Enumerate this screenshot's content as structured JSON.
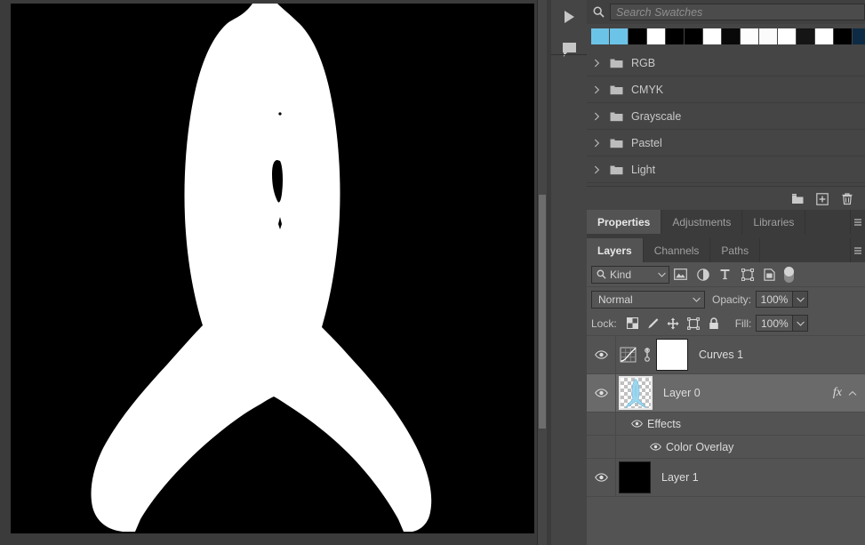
{
  "app": {
    "name": "Adobe Photoshop"
  },
  "document": {
    "canvas_background": "#000000",
    "artwork_color": "#ffffff",
    "artwork_name": "fish-silhouette",
    "zoom_scrollbar": {
      "visible": true
    }
  },
  "rail": {
    "buttons": [
      {
        "name": "play-icon",
        "label": "Play"
      },
      {
        "name": "comment-icon",
        "label": "Comment"
      }
    ]
  },
  "swatches": {
    "search": {
      "placeholder": "Search Swatches",
      "value": ""
    },
    "colors": [
      "#6cc3e8",
      "#6cc3e8",
      "#000000",
      "#ffffff",
      "#000000",
      "#000000",
      "#ffffff",
      "#090909",
      "#fdfdfd",
      "#fbfbfb",
      "#ffffff",
      "#151515",
      "#ffffff",
      "#000000",
      "#0d2b44"
    ],
    "groups": [
      {
        "label": "RGB"
      },
      {
        "label": "CMYK"
      },
      {
        "label": "Grayscale"
      },
      {
        "label": "Pastel"
      },
      {
        "label": "Light"
      }
    ],
    "footer_buttons": [
      {
        "name": "new-group-icon",
        "label": "Create new group"
      },
      {
        "name": "new-swatch-icon",
        "label": "Create new swatch"
      },
      {
        "name": "delete-swatch-icon",
        "label": "Delete swatch"
      }
    ]
  },
  "properties_tabs": {
    "tabs": [
      {
        "label": "Properties",
        "active": true
      },
      {
        "label": "Adjustments",
        "active": false
      },
      {
        "label": "Libraries",
        "active": false
      }
    ],
    "menu_label": "Panel menu"
  },
  "layers_tabs": {
    "tabs": [
      {
        "label": "Layers",
        "active": true
      },
      {
        "label": "Channels",
        "active": false
      },
      {
        "label": "Paths",
        "active": false
      }
    ],
    "menu_label": "Panel menu"
  },
  "layers_panel": {
    "filter": {
      "kind_label": "Kind",
      "icons": [
        {
          "name": "filter-pixel-icon"
        },
        {
          "name": "filter-adjustment-icon"
        },
        {
          "name": "filter-type-icon"
        },
        {
          "name": "filter-shape-icon"
        },
        {
          "name": "filter-smart-object-icon"
        }
      ],
      "toggle_on": false
    },
    "blend_mode": "Normal",
    "opacity_label": "Opacity:",
    "opacity_value": "100%",
    "lock_label": "Lock:",
    "lock_icons": [
      {
        "name": "lock-transparency-icon"
      },
      {
        "name": "lock-image-icon"
      },
      {
        "name": "lock-position-icon"
      },
      {
        "name": "lock-artboard-icon"
      },
      {
        "name": "lock-all-icon"
      }
    ],
    "fill_label": "Fill:",
    "fill_value": "100%",
    "layers": [
      {
        "name": "Curves 1",
        "type": "adjustment",
        "visible": true,
        "selected": false,
        "linked": true,
        "mask_color": "#ffffff"
      },
      {
        "name": "Layer 0",
        "type": "pixel",
        "visible": true,
        "selected": true,
        "has_fx": true,
        "fx_label": "fx",
        "effects": [
          {
            "label": "Effects",
            "visible": true,
            "level": 1
          },
          {
            "label": "Color Overlay",
            "visible": true,
            "level": 2
          }
        ]
      },
      {
        "name": "Layer 1",
        "type": "pixel",
        "visible": true,
        "selected": false,
        "thumb_color": "#000000"
      }
    ]
  },
  "theme": {
    "panel_bg": "#454545",
    "layers_bg": "#535353",
    "tabbar_bg": "#3b3b3b",
    "selected_row": "#6a6a6a",
    "text": "#c6c6c6",
    "accent_blue": "#6cc3e8"
  }
}
